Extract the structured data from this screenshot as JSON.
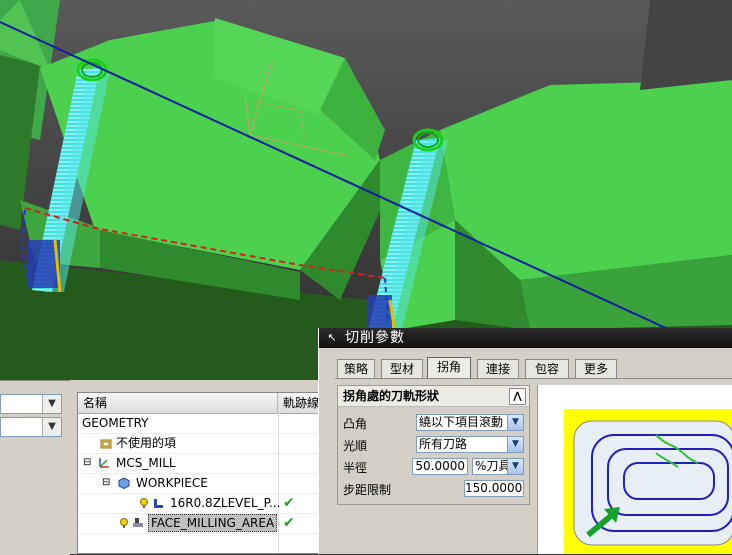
{
  "dialog": {
    "title": "切削參數",
    "tabs": [
      {
        "label": "策略",
        "active": false
      },
      {
        "label": "型材",
        "active": false
      },
      {
        "label": "拐角",
        "active": true
      },
      {
        "label": "連接",
        "active": false
      },
      {
        "label": "包容",
        "active": false
      },
      {
        "label": "更多",
        "active": false
      }
    ],
    "group_title": "拐角處的刀軌形狀",
    "fields": {
      "convex_corner": {
        "label": "凸角",
        "value": "繞以下項目滾動"
      },
      "smoothing": {
        "label": "光順",
        "value": "所有刀路"
      },
      "radius": {
        "label": "半徑",
        "value": "50.0000",
        "unit": "%刀具"
      },
      "step_limit": {
        "label": "步距限制",
        "value": "150.0000"
      }
    },
    "accent_color": "#ffff00"
  },
  "navigator": {
    "columns": [
      "名稱",
      "軌跡線"
    ],
    "rows": [
      {
        "label": "GEOMETRY",
        "icon": "none",
        "status": ""
      },
      {
        "label": "不使用的項",
        "icon": "folder-icon",
        "status": ""
      },
      {
        "label": "MCS_MILL",
        "icon": "mcs-icon",
        "status": ""
      },
      {
        "label": "WORKPIECE",
        "icon": "workpiece-icon",
        "status": ""
      },
      {
        "label": "16R0.8ZLEVEL_P...",
        "icon": "zlevel-operation-icon",
        "status": "✔"
      },
      {
        "label": "FACE_MILLING_AREA",
        "icon": "face-milling-operation-icon",
        "status": "✔"
      }
    ]
  }
}
